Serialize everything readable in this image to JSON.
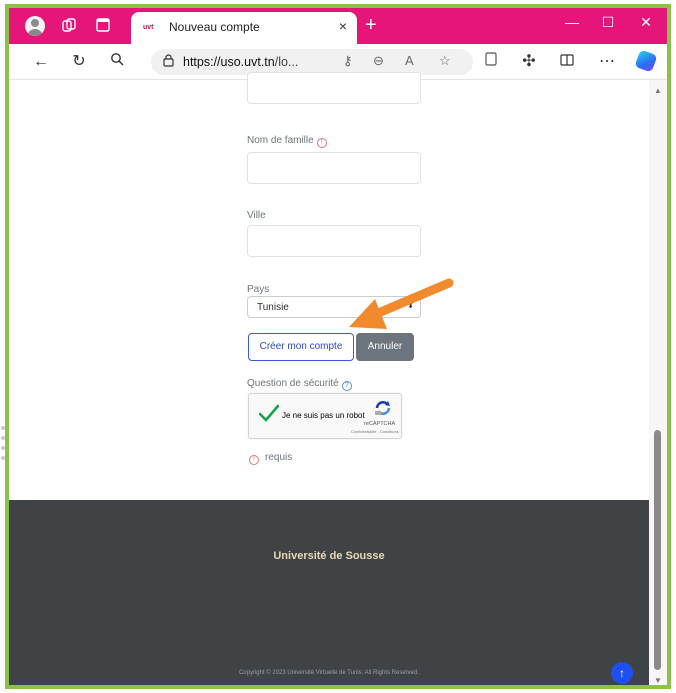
{
  "browser": {
    "tab_title": "Nouveau compte",
    "tab_favicon_text": "uvt",
    "url_host": "https://uso.uvt.tn",
    "url_rest": "/lo...",
    "new_tab_symbol": "+",
    "close_tab_symbol": "×"
  },
  "form": {
    "last_name_label": "Nom de famille",
    "city_label": "Ville",
    "country_label": "Pays",
    "country_value": "Tunisie",
    "create_button": "Créer mon compte",
    "cancel_button": "Annuler",
    "security_question_label": "Question de sécurité",
    "recaptcha_label": "Je ne suis pas un robot",
    "recaptcha_brand": "reCAPTCHA",
    "recaptcha_terms": "Confidentialité - Conditions",
    "required_note": "requis"
  },
  "footer": {
    "title": "Université de Sousse",
    "copyright": "Copyright © 2023 Université Virtuelle de Tunis. All Rights Reserved."
  },
  "colors": {
    "titlebar": "#e6157a",
    "frame": "#8bc34a",
    "primary": "#3b5bdb",
    "footer_bg": "#404346",
    "annotation_arrow": "#f08a2c"
  },
  "icons": [
    "profile-icon",
    "workspaces-icon",
    "tab-actions-icon",
    "back-icon",
    "refresh-icon",
    "search-icon",
    "lock-icon",
    "key-icon",
    "zoom-out-icon",
    "read-aloud-icon",
    "favorite-icon",
    "collections-icon",
    "extensions-icon",
    "split-screen-icon",
    "more-icon",
    "copilot-icon",
    "checkmark-icon",
    "recaptcha-logo-icon",
    "scroll-top-icon"
  ]
}
